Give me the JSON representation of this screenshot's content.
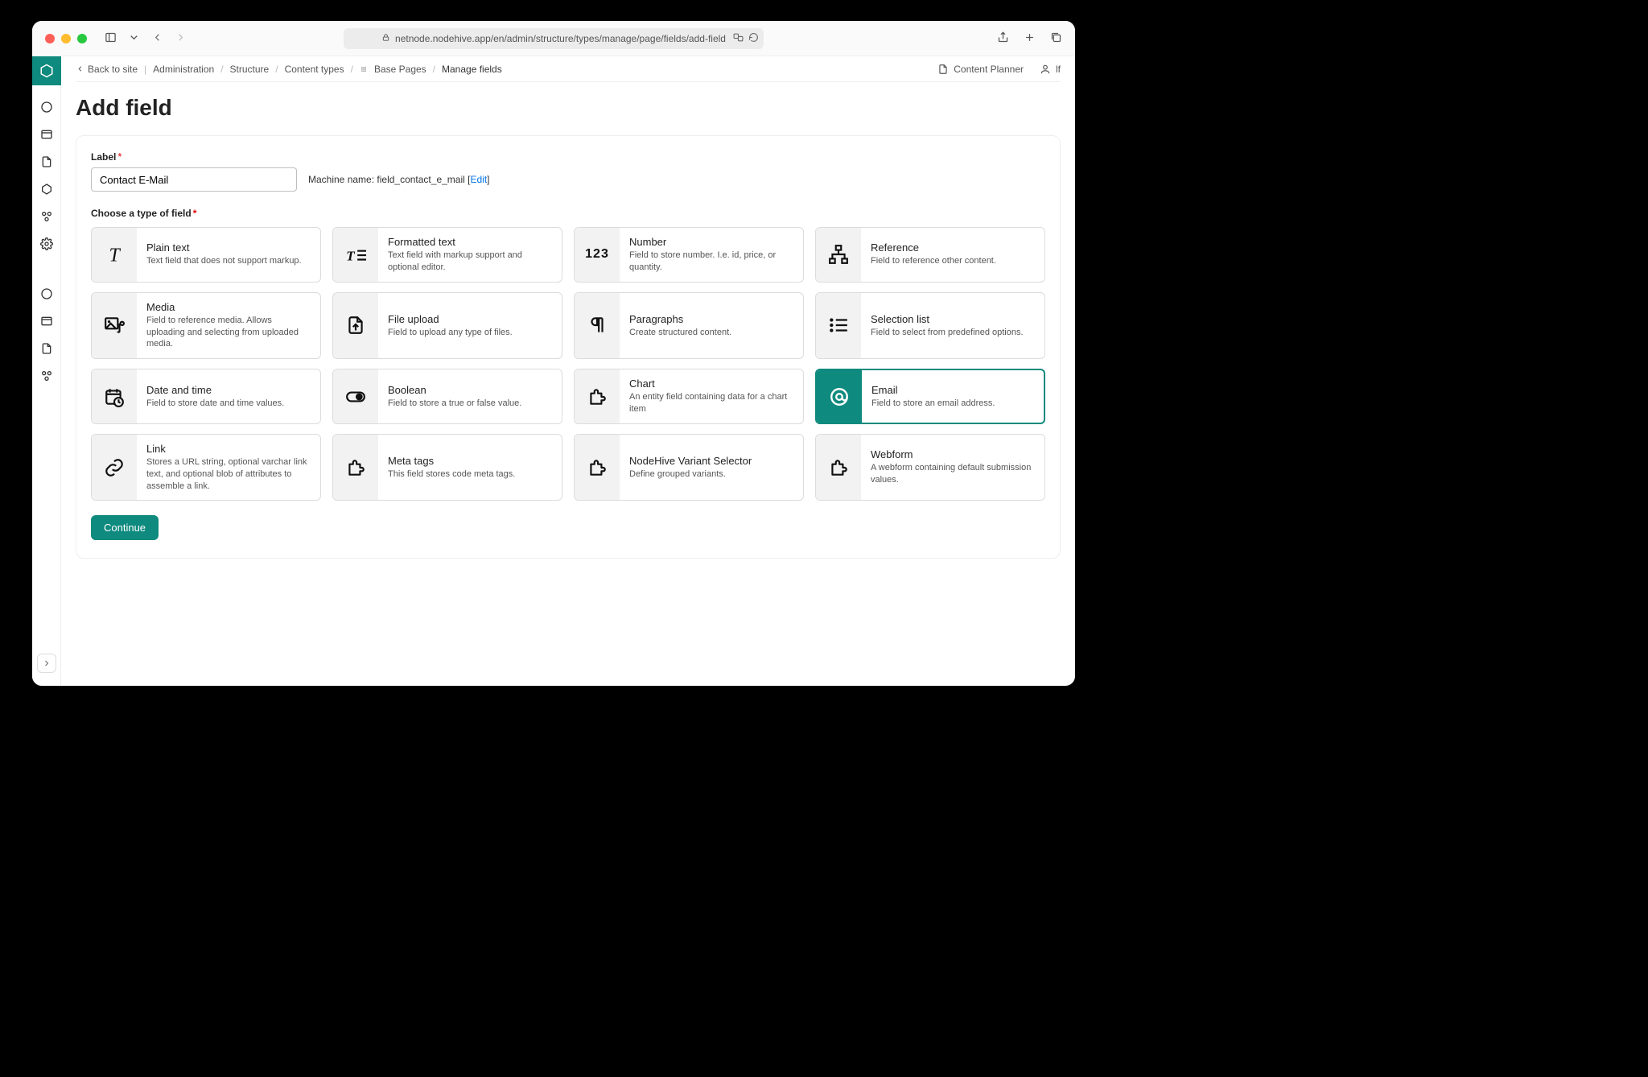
{
  "browser": {
    "url": "netnode.nodehive.app/en/admin/structure/types/manage/page/fields/add-field"
  },
  "topbar": {
    "back_to_site": "Back to site",
    "breadcrumb": {
      "admin": "Administration",
      "structure": "Structure",
      "content_types": "Content types",
      "base_pages": "Base Pages",
      "manage_fields": "Manage fields"
    },
    "content_planner": "Content Planner",
    "user": "lf"
  },
  "page": {
    "title": "Add field",
    "label_label": "Label",
    "label_value": "Contact E-Mail",
    "machine_prefix": "Machine name: ",
    "machine_name": "field_contact_e_mail",
    "edit": "Edit",
    "choose_label": "Choose a type of field",
    "continue": "Continue"
  },
  "field_types": [
    {
      "id": "plain_text",
      "title": "Plain text",
      "desc": "Text field that does not support markup.",
      "icon": "text-T",
      "selected": false
    },
    {
      "id": "formatted_text",
      "title": "Formatted text",
      "desc": "Text field with markup support and optional editor.",
      "icon": "text-formatted",
      "selected": false
    },
    {
      "id": "number",
      "title": "Number",
      "desc": "Field to store number. I.e. id, price, or quantity.",
      "icon": "number-123",
      "selected": false
    },
    {
      "id": "reference",
      "title": "Reference",
      "desc": "Field to reference other content.",
      "icon": "sitemap",
      "selected": false
    },
    {
      "id": "media",
      "title": "Media",
      "desc": "Field to reference media. Allows uploading and selecting from uploaded media.",
      "icon": "media",
      "selected": false
    },
    {
      "id": "file_upload",
      "title": "File upload",
      "desc": "Field to upload any type of files.",
      "icon": "file-upload",
      "selected": false
    },
    {
      "id": "paragraphs",
      "title": "Paragraphs",
      "desc": "Create structured content.",
      "icon": "paragraph",
      "selected": false
    },
    {
      "id": "selection_list",
      "title": "Selection list",
      "desc": "Field to select from predefined options.",
      "icon": "list",
      "selected": false
    },
    {
      "id": "date_time",
      "title": "Date and time",
      "desc": "Field to store date and time values.",
      "icon": "calendar-clock",
      "selected": false
    },
    {
      "id": "boolean",
      "title": "Boolean",
      "desc": "Field to store a true or false value.",
      "icon": "toggle",
      "selected": false
    },
    {
      "id": "chart",
      "title": "Chart",
      "desc": "An entity field containing data for a chart item",
      "icon": "puzzle",
      "selected": false
    },
    {
      "id": "email",
      "title": "Email",
      "desc": "Field to store an email address.",
      "icon": "at",
      "selected": true
    },
    {
      "id": "link",
      "title": "Link",
      "desc": "Stores a URL string, optional varchar link text, and optional blob of attributes to assemble a link.",
      "icon": "link",
      "selected": false
    },
    {
      "id": "meta_tags",
      "title": "Meta tags",
      "desc": "This field stores code meta tags.",
      "icon": "puzzle",
      "selected": false
    },
    {
      "id": "variant_sel",
      "title": "NodeHive Variant Selector",
      "desc": "Define grouped variants.",
      "icon": "puzzle",
      "selected": false
    },
    {
      "id": "webform",
      "title": "Webform",
      "desc": "A webform containing default submission values.",
      "icon": "puzzle",
      "selected": false
    }
  ]
}
